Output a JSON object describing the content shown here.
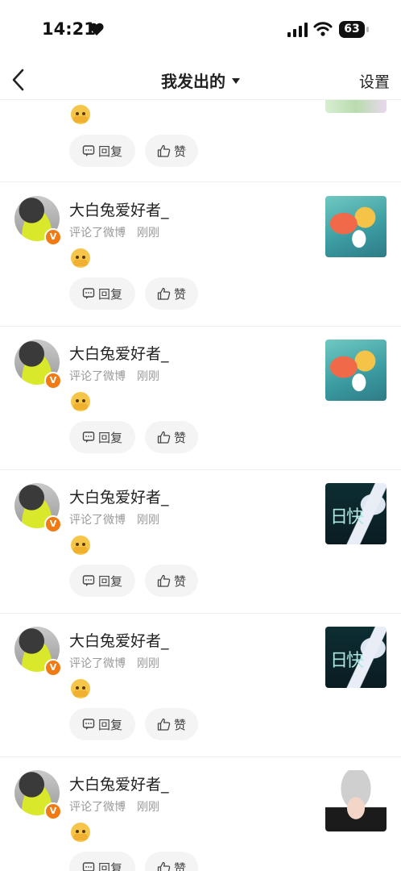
{
  "status_bar": {
    "time": "14:21",
    "battery": "63"
  },
  "nav": {
    "title": "我发出的",
    "settings": "设置"
  },
  "buttons": {
    "reply": "回复",
    "like": "赞"
  },
  "comments": [
    {
      "user": "大白兔爱好者_",
      "action": "评论了微博",
      "time": "刚刚",
      "thumb": "a"
    },
    {
      "user": "大白兔爱好者_",
      "action": "评论了微博",
      "time": "刚刚",
      "thumb": "a"
    },
    {
      "user": "大白兔爱好者_",
      "action": "评论了微博",
      "time": "刚刚",
      "thumb": "b"
    },
    {
      "user": "大白兔爱好者_",
      "action": "评论了微博",
      "time": "刚刚",
      "thumb": "b"
    },
    {
      "user": "大白兔爱好者_",
      "action": "评论了微博",
      "time": "刚刚",
      "thumb": "c"
    }
  ],
  "badge": "V",
  "thumb_glyph": "日快"
}
